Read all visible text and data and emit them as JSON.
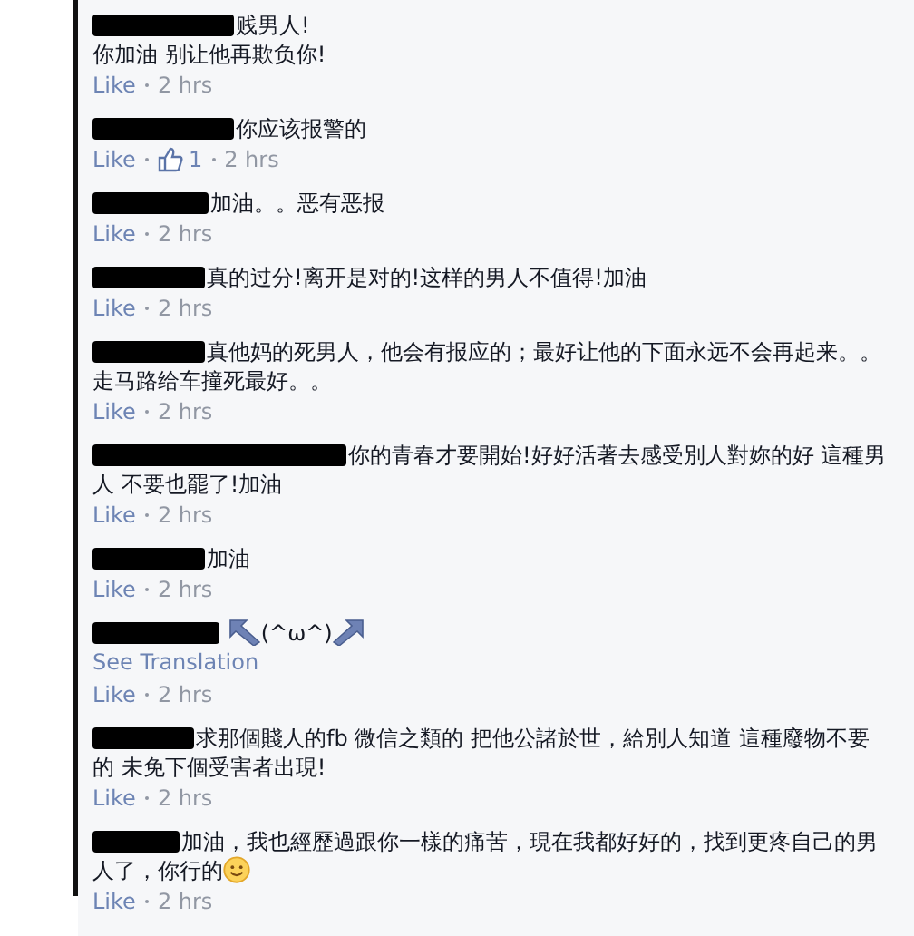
{
  "comments": [
    {
      "kind": "text",
      "text": "贱男人!\n你加油 别让他再欺负你!",
      "like": "Like",
      "time": "2 hrs"
    },
    {
      "kind": "text",
      "text": "你应该报警的",
      "like": "Like",
      "like_count": "1",
      "time": "2 hrs"
    },
    {
      "kind": "text",
      "text": "加油。。恶有恶报",
      "like": "Like",
      "time": "2 hrs"
    },
    {
      "kind": "text",
      "text": "真的过分!离开是对的!这样的男人不值得!加油",
      "like": "Like",
      "time": "2 hrs"
    },
    {
      "kind": "text",
      "text": "真他妈的死男人，他会有报应的；最好让他的下面永远不会再起来。。走马路给车撞死最好。。",
      "like": "Like",
      "time": "2 hrs"
    },
    {
      "kind": "text",
      "text": "你的青春才要開始!好好活著去感受別人對妳的好 這種男人 不要也罷了!加油",
      "like": "Like",
      "time": "2 hrs"
    },
    {
      "kind": "text",
      "text": "加油",
      "like": "Like",
      "time": "2 hrs"
    },
    {
      "kind": "kaomoji",
      "text": "(^ω^)",
      "see_translation": "See Translation",
      "like": "Like",
      "time": "2 hrs"
    },
    {
      "kind": "text",
      "text": "求那個賤人的fb 微信之類的 把他公諸於世，給別人知道 這種廢物不要的 未免下個受害者出現!",
      "like": "Like",
      "time": "2 hrs"
    },
    {
      "kind": "smiley",
      "text": "加油，我也經歷過跟你一樣的痛苦，現在我都好好的，找到更疼自己的男人了，你行的",
      "like": "Like",
      "time": "2 hrs"
    }
  ]
}
